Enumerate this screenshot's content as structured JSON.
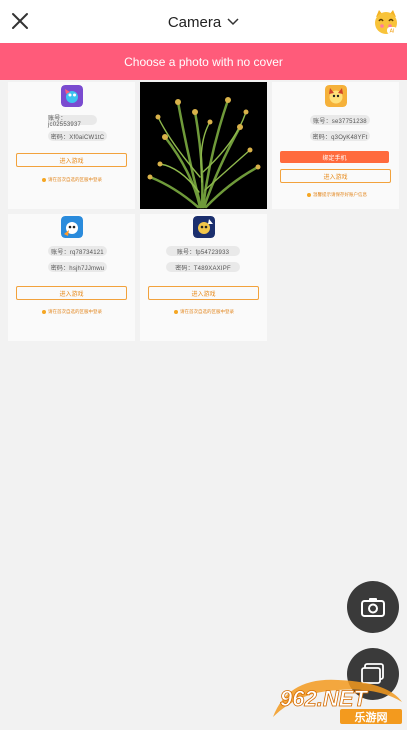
{
  "header": {
    "title": "Camera"
  },
  "banner": {
    "text": "Choose a photo with no cover"
  },
  "grid": {
    "tiles": [
      {
        "account": "账号：jc02553937",
        "password": "密码：Xf0aiCW1tC",
        "open_button": "进入游戏",
        "note": "请在首次自选的区服中登录"
      },
      {
        "account": "账号：se37751238",
        "password": "密码：q3OyK48YFt",
        "bind_button": "绑定手机",
        "open_button": "进入游戏",
        "note": "温馨提示请保存好账户信息"
      },
      {
        "account": "账号：rq78734121",
        "password": "密码：hsjh7JJmwu",
        "open_button": "进入游戏",
        "note": "请在首次自选的区服中登录"
      },
      {
        "account": "账号：fp54723933",
        "password": "密码：T489XAXIPF",
        "open_button": "进入游戏",
        "note": "请在首次自选的区服中登录"
      }
    ]
  },
  "watermark": {
    "logo": "962.NET",
    "subtext": "乐游网"
  },
  "colors": {
    "banner": "#ff5b7a",
    "accent": "#f2a23c",
    "fab": "#3a3a3a"
  }
}
